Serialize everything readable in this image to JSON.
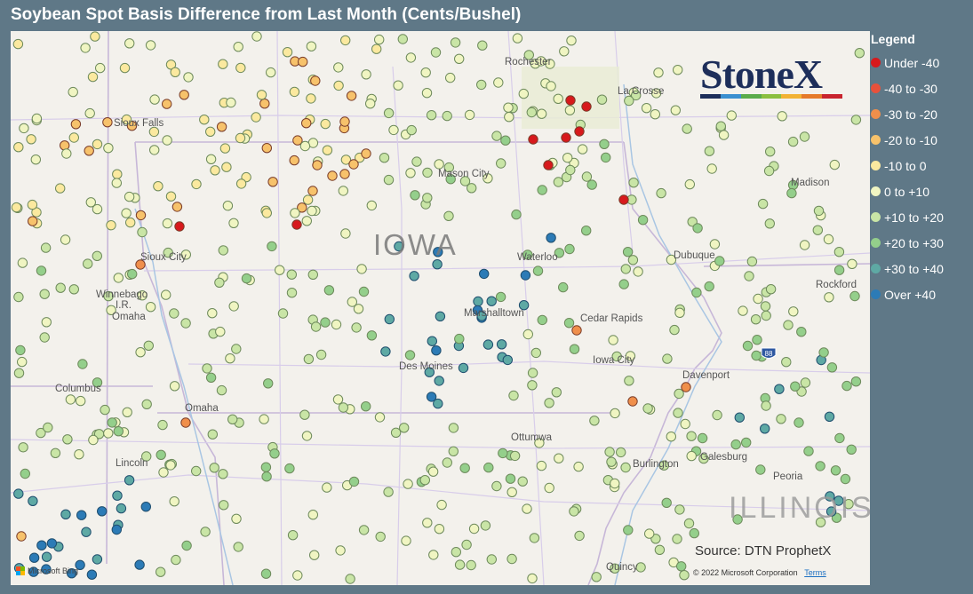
{
  "title": "Soybean Spot Basis Difference from Last Month (Cents/Bushel)",
  "legend": {
    "title": "Legend",
    "items": [
      {
        "label": "Under -40",
        "color": "#d7191c"
      },
      {
        "label": "-40 to -30",
        "color": "#e8513b"
      },
      {
        "label": "-30 to -20",
        "color": "#f08f4b"
      },
      {
        "label": "-20 to -10",
        "color": "#f7c26b"
      },
      {
        "label": "-10 to 0",
        "color": "#fbe99f"
      },
      {
        "label": "0 to +10",
        "color": "#f0f5c2"
      },
      {
        "label": "+10 to +20",
        "color": "#c9e5a6"
      },
      {
        "label": "+20 to +30",
        "color": "#94cf8b"
      },
      {
        "label": "+30 to +40",
        "color": "#5ea9a4"
      },
      {
        "label": "Over +40",
        "color": "#2c7bb6"
      }
    ]
  },
  "map": {
    "cities": [
      "Rochester",
      "La Crosse",
      "Sioux Falls",
      "Mason City",
      "Madison",
      "Sioux City",
      "Waterloo",
      "Dubuque",
      "Rockford",
      "Winnebago",
      "I.R.",
      "Omaha",
      "Marshalltown",
      "Cedar Rapids",
      "Iowa City",
      "Des Moines",
      "Davenport",
      "Columbus",
      "Omaha",
      "Ottumwa",
      "Lincoln",
      "Burlington",
      "Galesburg",
      "Peoria",
      "Quincy"
    ],
    "states": [
      "IOWA",
      "ILLINOIS"
    ],
    "highway_shield": "88"
  },
  "logo": {
    "text": "StoneX",
    "stripe_colors": [
      "#1d2e5a",
      "#3a8fd0",
      "#5aab4a",
      "#8bbf3f",
      "#f2b233",
      "#e57a2a",
      "#c8242e"
    ]
  },
  "source": "Source: DTN ProphetX",
  "copyright": "© 2022 Microsoft Corporation",
  "terms": "Terms",
  "bing": "Microsoft Bing"
}
